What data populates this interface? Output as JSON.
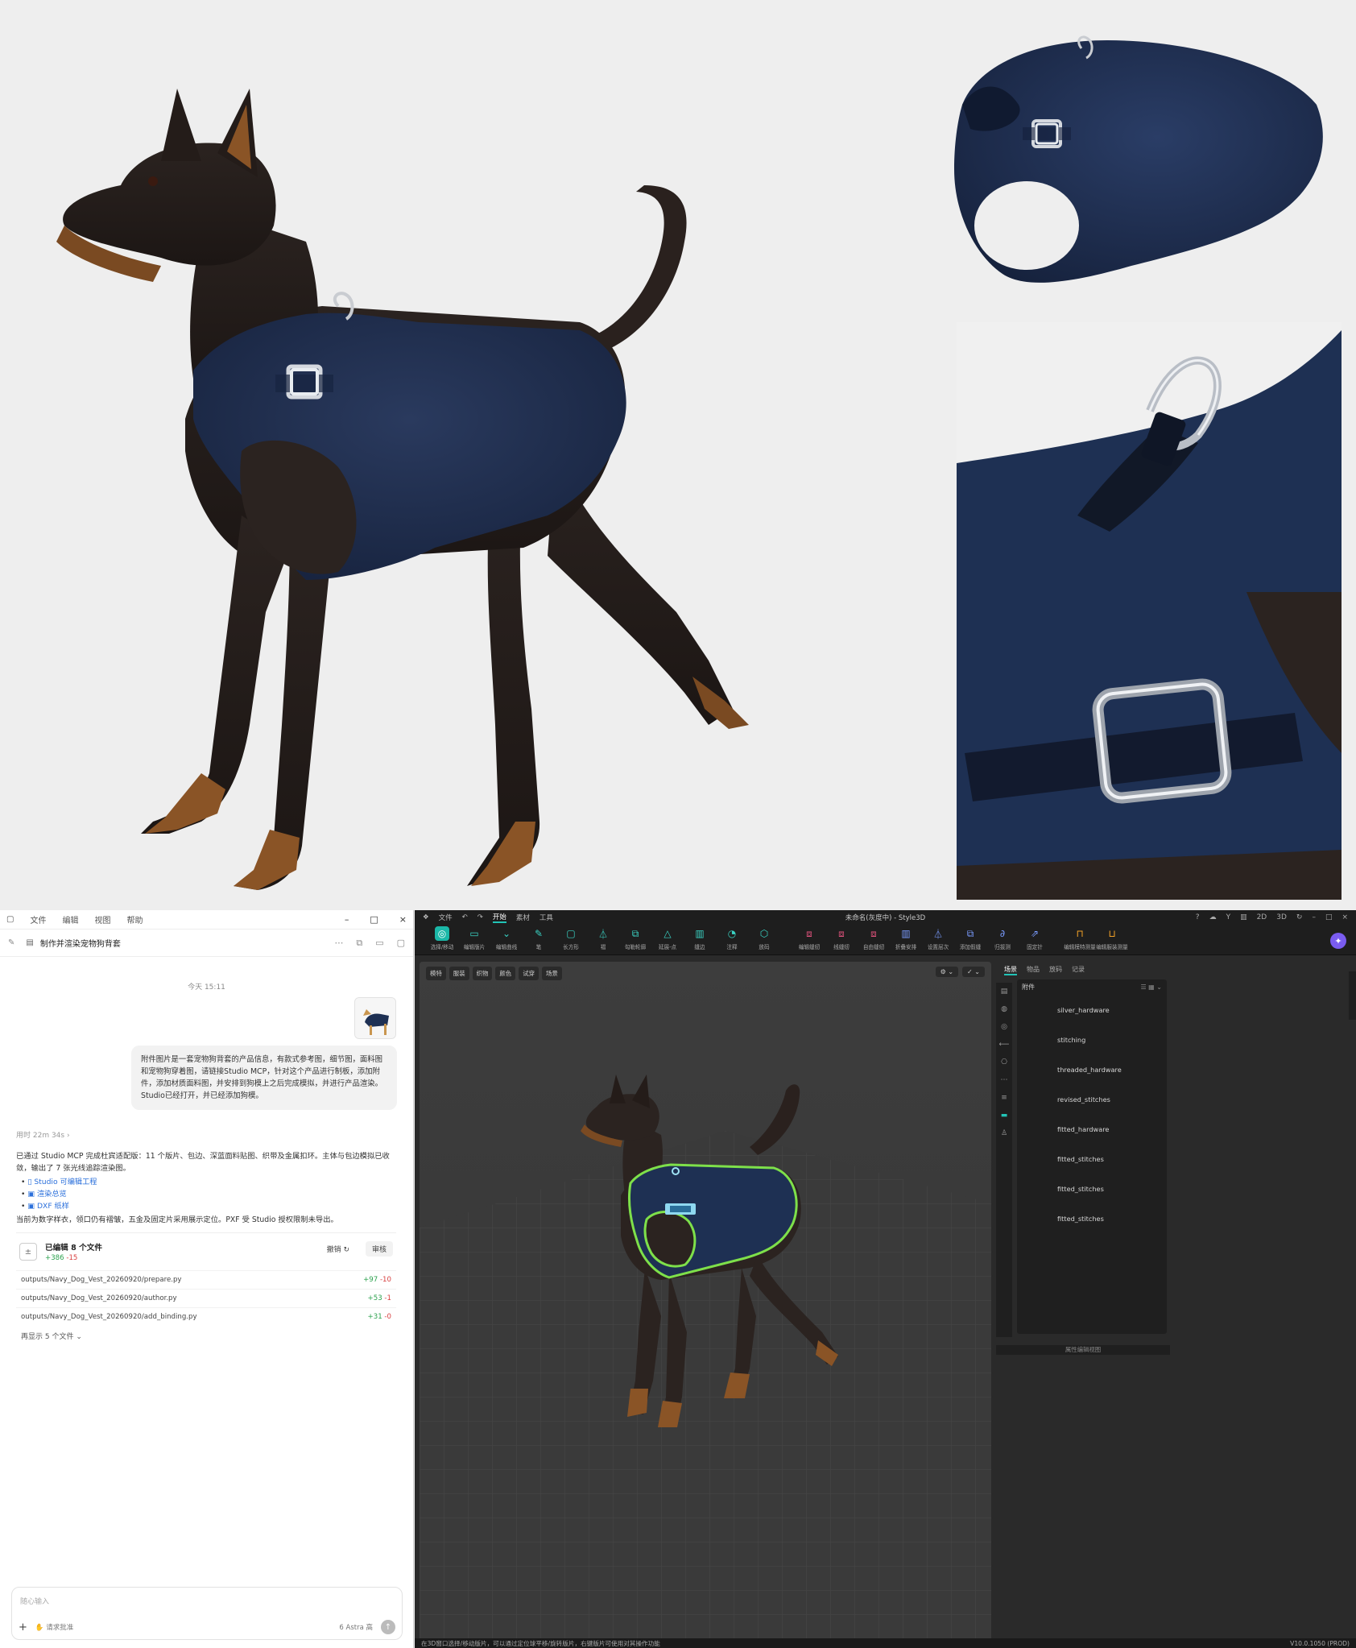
{
  "chat": {
    "menu": [
      "文件",
      "编辑",
      "视图",
      "帮助"
    ],
    "window_buttons": [
      "–",
      "□",
      "×"
    ],
    "conversation_title": "制作并渲染宠物狗背套",
    "date_label": "今天 15:11",
    "user_message": "附件图片是一套宠物狗背套的产品信息，有款式参考图，细节图，面料图和宠物狗穿着图，请链接Studio MCP，针对这个产品进行制板，添加附件，添加材质面料图，并安排到狗模上之后完成模拟，并进行产品渲染。Studio已经打开，并已经添加狗模。",
    "elapsed": "用时 22m 34s",
    "reply_text": "已通过 Studio MCP 完成杜宾适配版：11 个版片、包边、深蓝面料贴图、织带及金属扣环。主体与包边模拟已收敛，输出了 7 张光线追踪渲染图。",
    "links": [
      "Studio 可编辑工程",
      "渲染总览",
      "DXF 纸样"
    ],
    "note": "当前为数字样衣，领口仍有褶皱，五金及固定片采用展示定位。PXF 受 Studio 授权限制未导出。",
    "edited": {
      "title": "已编辑 8 个文件",
      "added": "+386",
      "removed": "-15",
      "undo_label": "撤销 ↻",
      "review_label": "审核",
      "files": [
        {
          "path": "outputs/Navy_Dog_Vest_20260920/prepare.py",
          "added": "+97",
          "removed": "-10"
        },
        {
          "path": "outputs/Navy_Dog_Vest_20260920/author.py",
          "added": "+53",
          "removed": "-1"
        },
        {
          "path": "outputs/Navy_Dog_Vest_20260920/add_binding.py",
          "added": "+31",
          "removed": "-0"
        }
      ],
      "show_more": "再显示 5 个文件"
    },
    "input": {
      "placeholder": "随心输入",
      "mode": "请求批准",
      "model": "6 Astra 高"
    }
  },
  "app": {
    "title": "未命名(灰度中) - Style3D",
    "menu": [
      "文件",
      "开始",
      "素材",
      "工具"
    ],
    "active_menu": "开始",
    "right_labels": [
      "2D",
      "3D"
    ],
    "tools": [
      {
        "label": "选择/移动",
        "icon": "◎",
        "variant": "active"
      },
      {
        "label": "编辑版片",
        "icon": "▭",
        "variant": ""
      },
      {
        "label": "编辑曲线",
        "icon": "⌄",
        "variant": ""
      },
      {
        "label": "笔",
        "icon": "✎",
        "variant": ""
      },
      {
        "label": "长方形",
        "icon": "▢",
        "variant": ""
      },
      {
        "label": "褶",
        "icon": "⏃",
        "variant": ""
      },
      {
        "label": "勾勒轮廓",
        "icon": "⧉",
        "variant": ""
      },
      {
        "label": "延展-点",
        "icon": "△",
        "variant": ""
      },
      {
        "label": "缝边",
        "icon": "▥",
        "variant": ""
      },
      {
        "label": "注释",
        "icon": "◔",
        "variant": ""
      },
      {
        "label": "放码",
        "icon": "⬡",
        "variant": ""
      },
      {
        "label": "编辑缝纫",
        "icon": "⧈",
        "variant": "pink"
      },
      {
        "label": "线缝纫",
        "icon": "⧈",
        "variant": "pink"
      },
      {
        "label": "自由缝纫",
        "icon": "⧈",
        "variant": "pink"
      },
      {
        "label": "折叠安排",
        "icon": "▥",
        "variant": "blue"
      },
      {
        "label": "设置层次",
        "icon": "⏃",
        "variant": "blue"
      },
      {
        "label": "添加假缝",
        "icon": "⧉",
        "variant": "blue"
      },
      {
        "label": "归拔测",
        "icon": "∂",
        "variant": "blue"
      },
      {
        "label": "固定针",
        "icon": "⇗",
        "variant": "blue"
      },
      {
        "label": "编辑模特测量",
        "icon": "⊓",
        "variant": "orange"
      },
      {
        "label": "编辑服装测量",
        "icon": "⊔",
        "variant": "orange"
      }
    ],
    "view_tabs": [
      "模特",
      "服装",
      "织物",
      "颜色",
      "试穿",
      "场景"
    ],
    "right_tabs": [
      "场景",
      "物品",
      "放码",
      "记录"
    ],
    "panel_header": "附件",
    "objects": [
      "silver_hardware",
      "stitching",
      "threaded_hardware",
      "revised_stitches",
      "fitted_hardware",
      "fitted_stitches",
      "fitted_stitches",
      "fitted_stitches"
    ],
    "attr_panel": "属性编辑视图",
    "status_text": "在3D窗口选择/移动版片，可以通过定位球平移/旋转版片，右键版片可使用对其操作功能",
    "version": "V10.0.1050 (PROD)"
  },
  "colors": {
    "vest_navy": "#1e3053",
    "binding_green": "#7ee04a",
    "accent_teal": "#22c3b6"
  }
}
